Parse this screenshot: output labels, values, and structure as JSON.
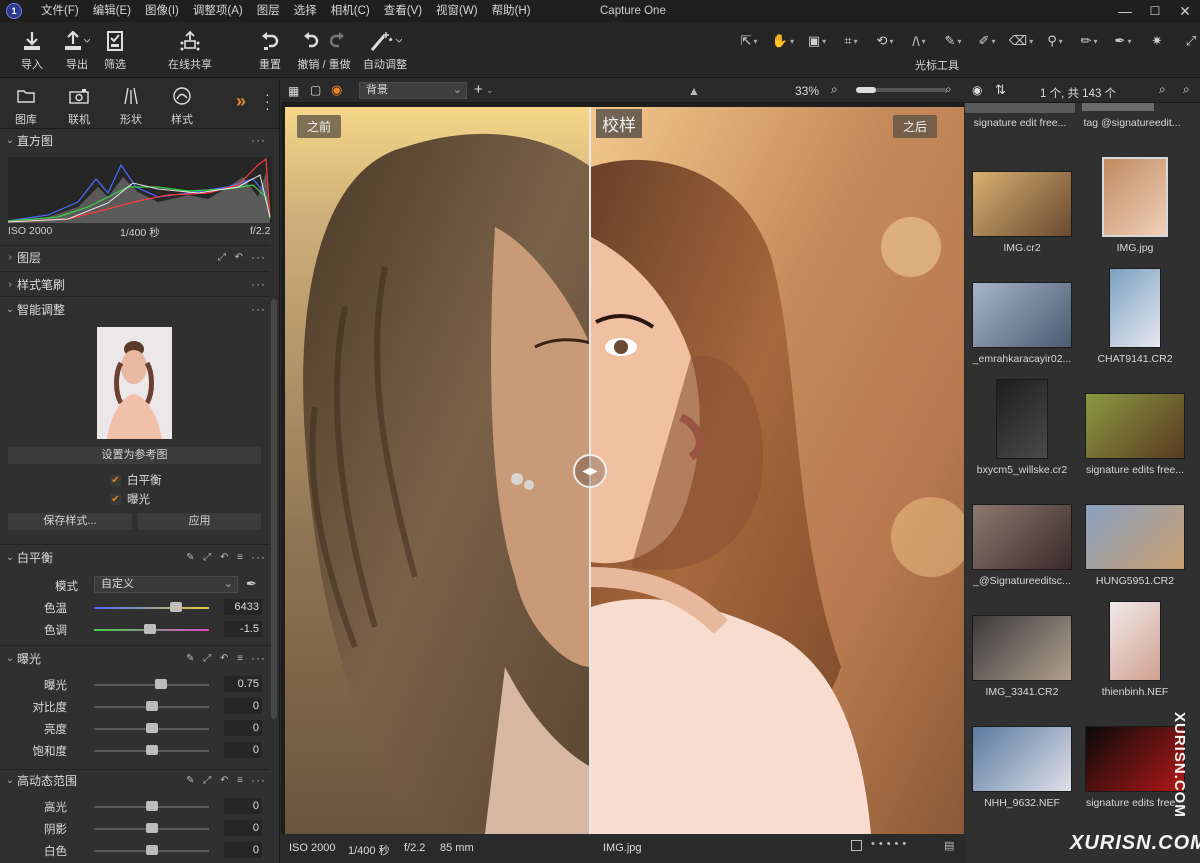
{
  "menubar": {
    "items": [
      "文件(F)",
      "编辑(E)",
      "图像(I)",
      "调整项(A)",
      "图层",
      "选择",
      "相机(C)",
      "查看(V)",
      "视窗(W)",
      "帮助(H)"
    ],
    "title": "Capture One",
    "minimize": "—",
    "maximize": "☐",
    "close": "✕"
  },
  "toolbar": {
    "import": "导入",
    "export": "导出",
    "filter": "筛选",
    "share": "在线共享",
    "reset": "重置",
    "undo_redo": "撤销 / 重做",
    "auto_adjust": "自动调整",
    "cursor_tools": "光标工具"
  },
  "tool_tabs": [
    "图库",
    "联机",
    "形状",
    "样式"
  ],
  "sections": {
    "histogram": "直方图",
    "layers": "图层",
    "style_brush": "样式笔刷",
    "smart_adjust": "智能调整",
    "white_balance": "白平衡",
    "exposure": "曝光",
    "hdr": "高动态范围"
  },
  "histogram_info": {
    "iso": "ISO 2000",
    "shutter": "1/400 秒",
    "aperture": "f/2.2"
  },
  "smart_adjust": {
    "set_reference": "设置为参考图",
    "check_wb": "白平衡",
    "check_exposure": "曝光",
    "save_style": "保存样式...",
    "apply": "应用",
    "check_mark": "✔"
  },
  "white_balance": {
    "mode_label": "模式",
    "mode_value": "自定义",
    "kelvin_label": "色温",
    "kelvin_value": "6433",
    "tint_label": "色调",
    "tint_value": "-1.5"
  },
  "exposure": {
    "rows": [
      {
        "label": "曝光",
        "value": "0.75",
        "level": 0.58
      },
      {
        "label": "对比度",
        "value": "0",
        "level": 0.5
      },
      {
        "label": "亮度",
        "value": "0",
        "level": 0.5
      },
      {
        "label": "饱和度",
        "value": "0",
        "level": 0.5
      }
    ]
  },
  "hdr": {
    "rows": [
      {
        "label": "高光",
        "value": "0",
        "level": 0.5
      },
      {
        "label": "阴影",
        "value": "0",
        "level": 0.5
      },
      {
        "label": "白色",
        "value": "0",
        "level": 0.5
      }
    ]
  },
  "viewer_bar": {
    "layer_select": "背景",
    "zoom": "33%"
  },
  "viewer": {
    "before": "之前",
    "after": "之后",
    "proof": "校样"
  },
  "viewer_status": {
    "iso": "ISO 2000",
    "shutter": "1/400 秒",
    "aperture": "f/2.2",
    "focal": "85 mm",
    "filename": "IMG.jpg"
  },
  "browser_bar": {
    "count": "1 个, 共 143 个"
  },
  "browser": {
    "top_names": [
      "signature edit free...",
      "tag @signatureedit..."
    ],
    "thumbs": [
      {
        "name": "IMG.cr2"
      },
      {
        "name": "IMG.jpg"
      },
      {
        "name": "_emrahkaracayir02..."
      },
      {
        "name": "CHAT9141.CR2"
      },
      {
        "name": "bxycm5_willske.cr2"
      },
      {
        "name": "signature edits free..."
      },
      {
        "name": "_@Signatureeditsc..."
      },
      {
        "name": "HUNG5951.CR2"
      },
      {
        "name": "IMG_3341.CR2"
      },
      {
        "name": "thienbinh.NEF"
      },
      {
        "name": "NHH_9632.NEF"
      },
      {
        "name": "signature edits free..."
      }
    ]
  },
  "watermark": {
    "side": "XURISN.COM",
    "bottom": "XURISN.COM"
  }
}
